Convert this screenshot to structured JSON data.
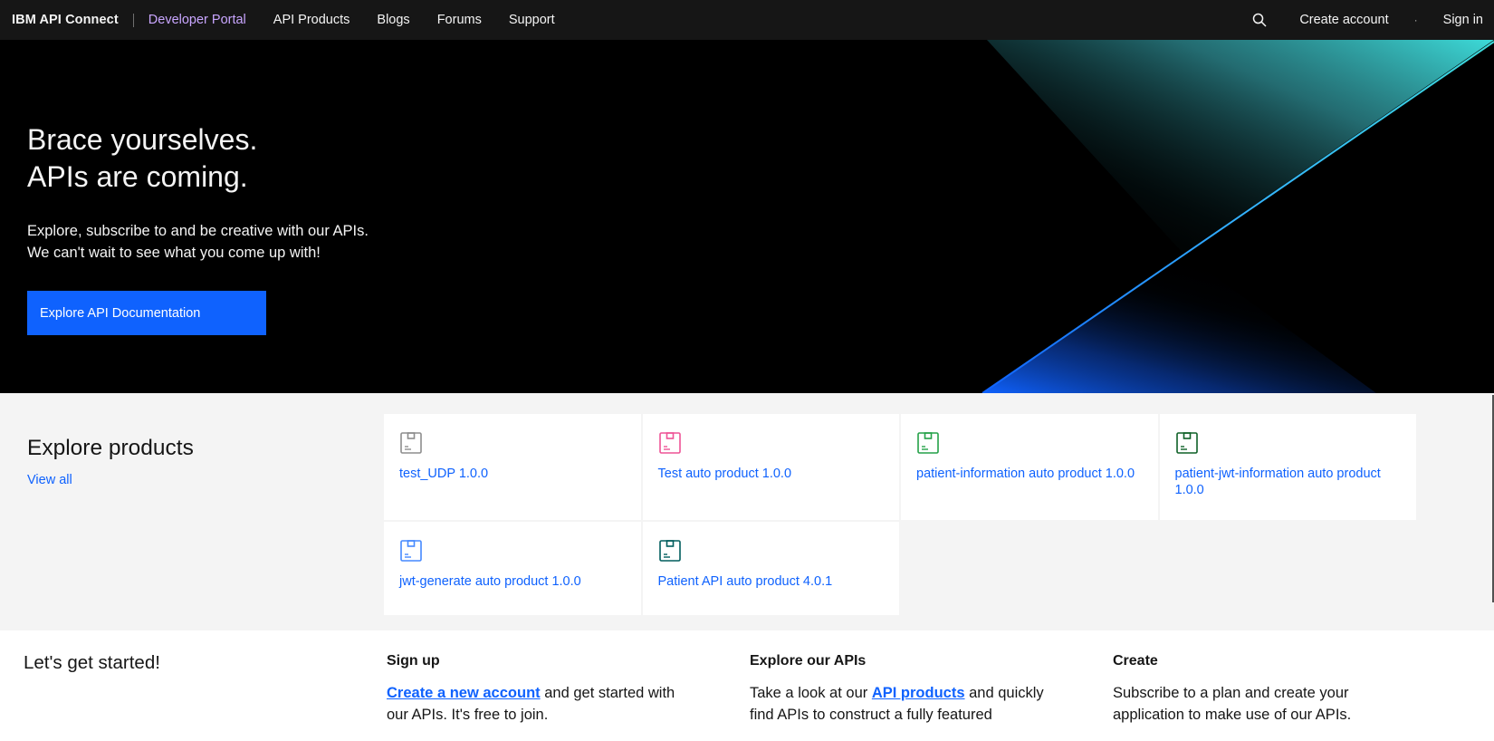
{
  "nav": {
    "brand": "IBM API Connect",
    "portal": "Developer Portal",
    "links": [
      "API Products",
      "Blogs",
      "Forums",
      "Support"
    ],
    "search_icon": "search-icon",
    "create_account": "Create account",
    "separator": "·",
    "sign_in": "Sign in"
  },
  "hero": {
    "title_line1": "Brace yourselves.",
    "title_line2": "APIs are coming.",
    "subtitle_line1": "Explore, subscribe to and be creative with our APIs.",
    "subtitle_line2": "We can't wait to see what you come up with!",
    "cta_label": "Explore API Documentation",
    "colors": {
      "teal": "#3ddbd9",
      "blue": "#0f62fe",
      "cta": "#0f62fe"
    }
  },
  "products": {
    "heading": "Explore products",
    "view_all": "View all",
    "items": [
      {
        "title": "test_UDP 1.0.0",
        "icon": "product-box-icon",
        "icon_color": "#8d8d8d"
      },
      {
        "title": "Test auto product 1.0.0",
        "icon": "product-box-icon",
        "icon_color": "#ee5396"
      },
      {
        "title": "patient-information auto product 1.0.0",
        "icon": "product-box-icon",
        "icon_color": "#24a148"
      },
      {
        "title": "patient-jwt-information auto product 1.0.0",
        "icon": "product-box-icon",
        "icon_color": "#0e6027"
      },
      {
        "title": "jwt-generate auto product 1.0.0",
        "icon": "product-box-icon",
        "icon_color": "#4589ff"
      },
      {
        "title": "Patient API auto product 4.0.1",
        "icon": "product-box-icon",
        "icon_color": "#005d5d"
      }
    ]
  },
  "started": {
    "heading": "Let's get started!",
    "columns": [
      {
        "title": "Sign up",
        "link": "Create a new account",
        "text_before": "",
        "text_after": " and get started with our APIs. It's free to join."
      },
      {
        "title": "Explore our APIs",
        "text_before": "Take a look at our ",
        "link": "API products",
        "text_after": " and quickly find APIs to construct a fully featured"
      },
      {
        "title": "Create",
        "text_before": "Subscribe to a plan and create your application to make use of our APIs.",
        "link": "",
        "text_after": ""
      }
    ]
  }
}
